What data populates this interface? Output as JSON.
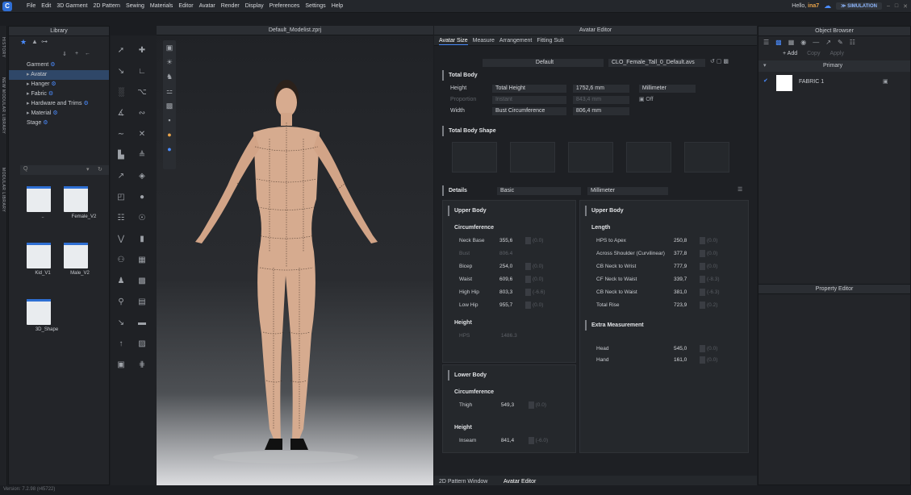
{
  "menubar": {
    "logo": "C",
    "menus": [
      "File",
      "Edit",
      "3D Garment",
      "2D Pattern",
      "Sewing",
      "Materials",
      "Editor",
      "Avatar",
      "Render",
      "Display",
      "Preferences",
      "Settings",
      "Help"
    ],
    "greeting": "Hello,",
    "username": "ina7",
    "simulation": "SIMULATION"
  },
  "sidebar_labels": [
    "HISTORY",
    "NEW MODULAR LIBRARY",
    "MODULAR LIBRARY"
  ],
  "library": {
    "title": "Library",
    "tree": [
      {
        "label": "Garment",
        "blue": "⚙"
      },
      {
        "label": "Avatar",
        "blue": "",
        "selected": true
      },
      {
        "label": "Hanger",
        "blue": "⚙"
      },
      {
        "label": "Fabric",
        "blue": "⚙"
      },
      {
        "label": "Hardware and Trims",
        "blue": "⚙"
      },
      {
        "label": "Material",
        "blue": "⚙"
      },
      {
        "label": "Stage",
        "blue": "⚙"
      }
    ],
    "search_placeholder": "Q",
    "tiles": [
      "..",
      "Female_V2",
      "Kid_V1",
      "Male_V2",
      "3D_Shape"
    ]
  },
  "viewport": {
    "title": "Default_Modelist.zprj"
  },
  "avatar_editor": {
    "title": "Avatar Editor",
    "tabs": [
      "Avatar Size",
      "Measure",
      "Arrangement",
      "Fitting Suit"
    ],
    "preset": "Default",
    "file": "CLO_Female_Tall_0_Default.avs",
    "total_body": {
      "title": "Total Body",
      "height_label": "Height",
      "height_type": "Total Height",
      "height_value": "1752,6 mm",
      "unit": "Millimeter",
      "proportion_label": "Proportion",
      "proportion_type": "Instant",
      "proportion_value": "843,4 mm",
      "off_label": "Off",
      "width_label": "Width",
      "width_type": "Bust Circumference",
      "width_value": "806,4 mm"
    },
    "total_body_shape": "Total Body Shape",
    "details": {
      "title": "Details",
      "mode": "Basic",
      "unit": "Millimeter"
    },
    "upper_body_left": {
      "title": "Upper Body",
      "circ_title": "Circumference",
      "rows": [
        {
          "label": "Neck Base",
          "value": "355,6",
          "delta": "(0.0)"
        },
        {
          "label": "Bust",
          "value": "806.4",
          "delta": "",
          "dim": true
        },
        {
          "label": "Bicep",
          "value": "254,0",
          "delta": "(0.0)"
        },
        {
          "label": "Waist",
          "value": "609,6",
          "delta": "(0.0)"
        },
        {
          "label": "High Hip",
          "value": "803,3",
          "delta": "(-6.6)"
        },
        {
          "label": "Low Hip",
          "value": "955,7",
          "delta": "(0.0)"
        }
      ],
      "height_title": "Height",
      "height_rows": [
        {
          "label": "HPS",
          "value": "1486.3",
          "dim": true
        }
      ]
    },
    "lower_body": {
      "title": "Lower Body",
      "circ_title": "Circumference",
      "rows": [
        {
          "label": "Thigh",
          "value": "549,3",
          "delta": "(0.0)"
        }
      ],
      "height_title": "Height",
      "height_rows": [
        {
          "label": "Inseam",
          "value": "841,4",
          "delta": "(-6.0)"
        }
      ]
    },
    "upper_body_right": {
      "title": "Upper Body",
      "length_title": "Length",
      "rows": [
        {
          "label": "HPS to Apex",
          "value": "250,8",
          "delta": "(0.0)"
        },
        {
          "label": "Across Shoulder (Curvilinear)",
          "value": "377,8",
          "delta": "(0.0)"
        },
        {
          "label": "CB Neck to Wrist",
          "value": "777,9",
          "delta": "(0.0)"
        },
        {
          "label": "CF Neck to Waist",
          "value": "339,7",
          "delta": "(-8.3)"
        },
        {
          "label": "CB Neck to Waist",
          "value": "381,0",
          "delta": "(-6.3)"
        },
        {
          "label": "Total Rise",
          "value": "723,9",
          "delta": "(0.2)"
        }
      ]
    },
    "extra": {
      "title": "Extra Measurement",
      "rows": [
        {
          "label": "Head",
          "value": "545,0",
          "delta": "(0.0)"
        },
        {
          "label": "Hand",
          "value": "161,0",
          "delta": "(0.0)"
        }
      ]
    }
  },
  "object_browser": {
    "title": "Object Browser",
    "add": "+ Add",
    "copy": "Copy",
    "apply": "Apply",
    "primary": "Primary",
    "fabric": "FABRIC 1"
  },
  "property_editor": {
    "title": "Property Editor"
  },
  "bottom_tabs": [
    "2D Pattern Window",
    "Avatar Editor"
  ],
  "version": "Version: 7.2.98 (r45722)"
}
